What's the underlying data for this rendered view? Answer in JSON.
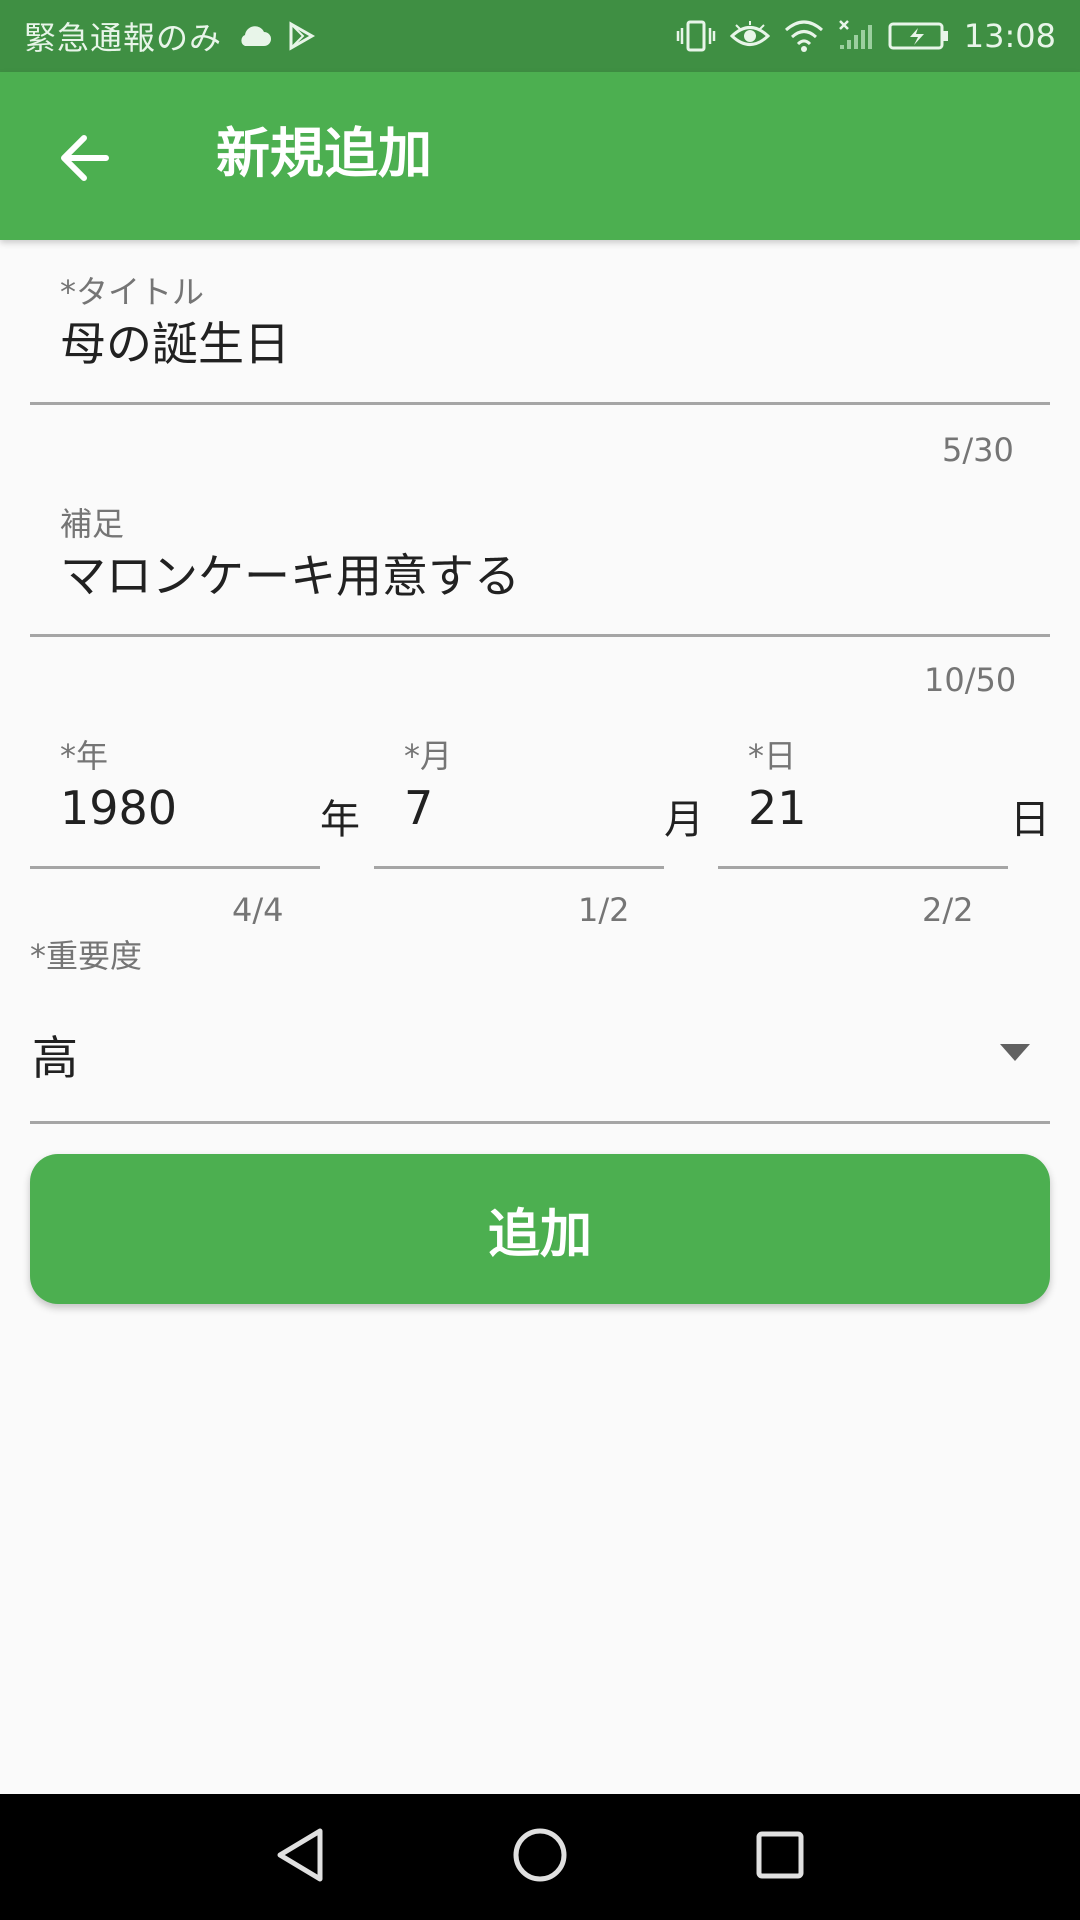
{
  "status_bar": {
    "left_text": "緊急通報のみ",
    "time": "13:08",
    "icons": [
      "cloud-icon",
      "play-store-icon",
      "vibrate-icon",
      "eye-icon",
      "wifi-icon",
      "signal-icon",
      "battery-icon"
    ]
  },
  "app_bar": {
    "title": "新規追加",
    "back_icon": "arrow-back-icon"
  },
  "form": {
    "title_field": {
      "label": "*タイトル",
      "value": "母の誕生日",
      "counter": "5/30"
    },
    "note_field": {
      "label": "補足",
      "value": "マロンケーキ用意する",
      "counter": "10/50"
    },
    "year_field": {
      "label": "*年",
      "value": "1980",
      "unit": "年",
      "counter": "4/4"
    },
    "month_field": {
      "label": "*月",
      "value": "7",
      "unit": "月",
      "counter": "1/2"
    },
    "day_field": {
      "label": "*日",
      "value": "21",
      "unit": "日",
      "counter": "2/2"
    },
    "priority": {
      "label": "*重要度",
      "selected": "高"
    }
  },
  "add_button": {
    "label": "追加"
  },
  "colors": {
    "primary": "#4caf50",
    "primary_dark": "#3f8f43",
    "background": "#fafafa"
  },
  "nav_bar": {
    "icons": [
      "nav-back-icon",
      "nav-home-icon",
      "nav-recents-icon"
    ]
  }
}
